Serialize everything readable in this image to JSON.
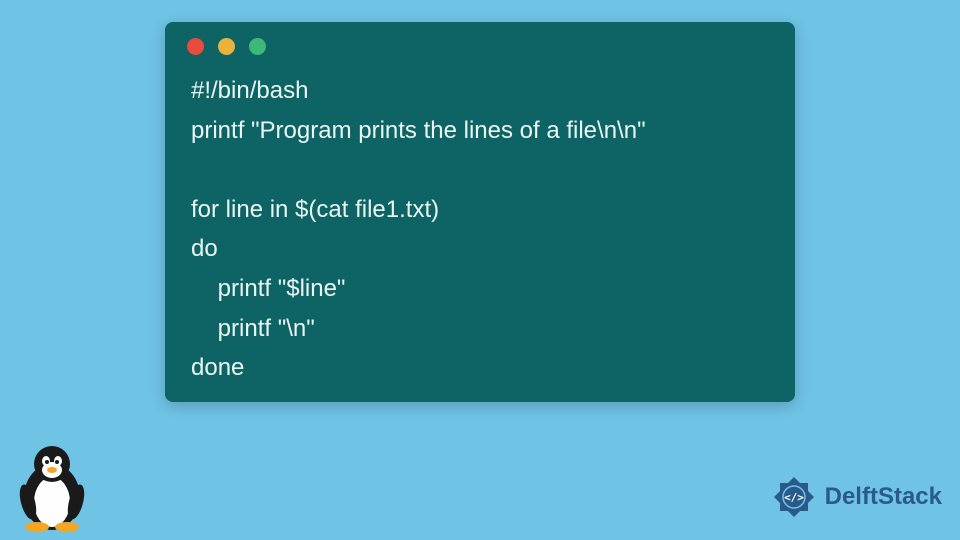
{
  "window": {
    "dots": [
      "red",
      "yellow",
      "green"
    ]
  },
  "code": {
    "lines": [
      "#!/bin/bash",
      "printf \"Program prints the lines of a file\\n\\n\"",
      "",
      "for line in $(cat file1.txt)",
      "do",
      "    printf \"$line\"",
      "    printf \"\\n\"",
      "done"
    ]
  },
  "brand": {
    "name": "DelftStack"
  },
  "colors": {
    "bg": "#6fc3e5",
    "window": "#0e6464",
    "brand": "#2a5a8a"
  }
}
